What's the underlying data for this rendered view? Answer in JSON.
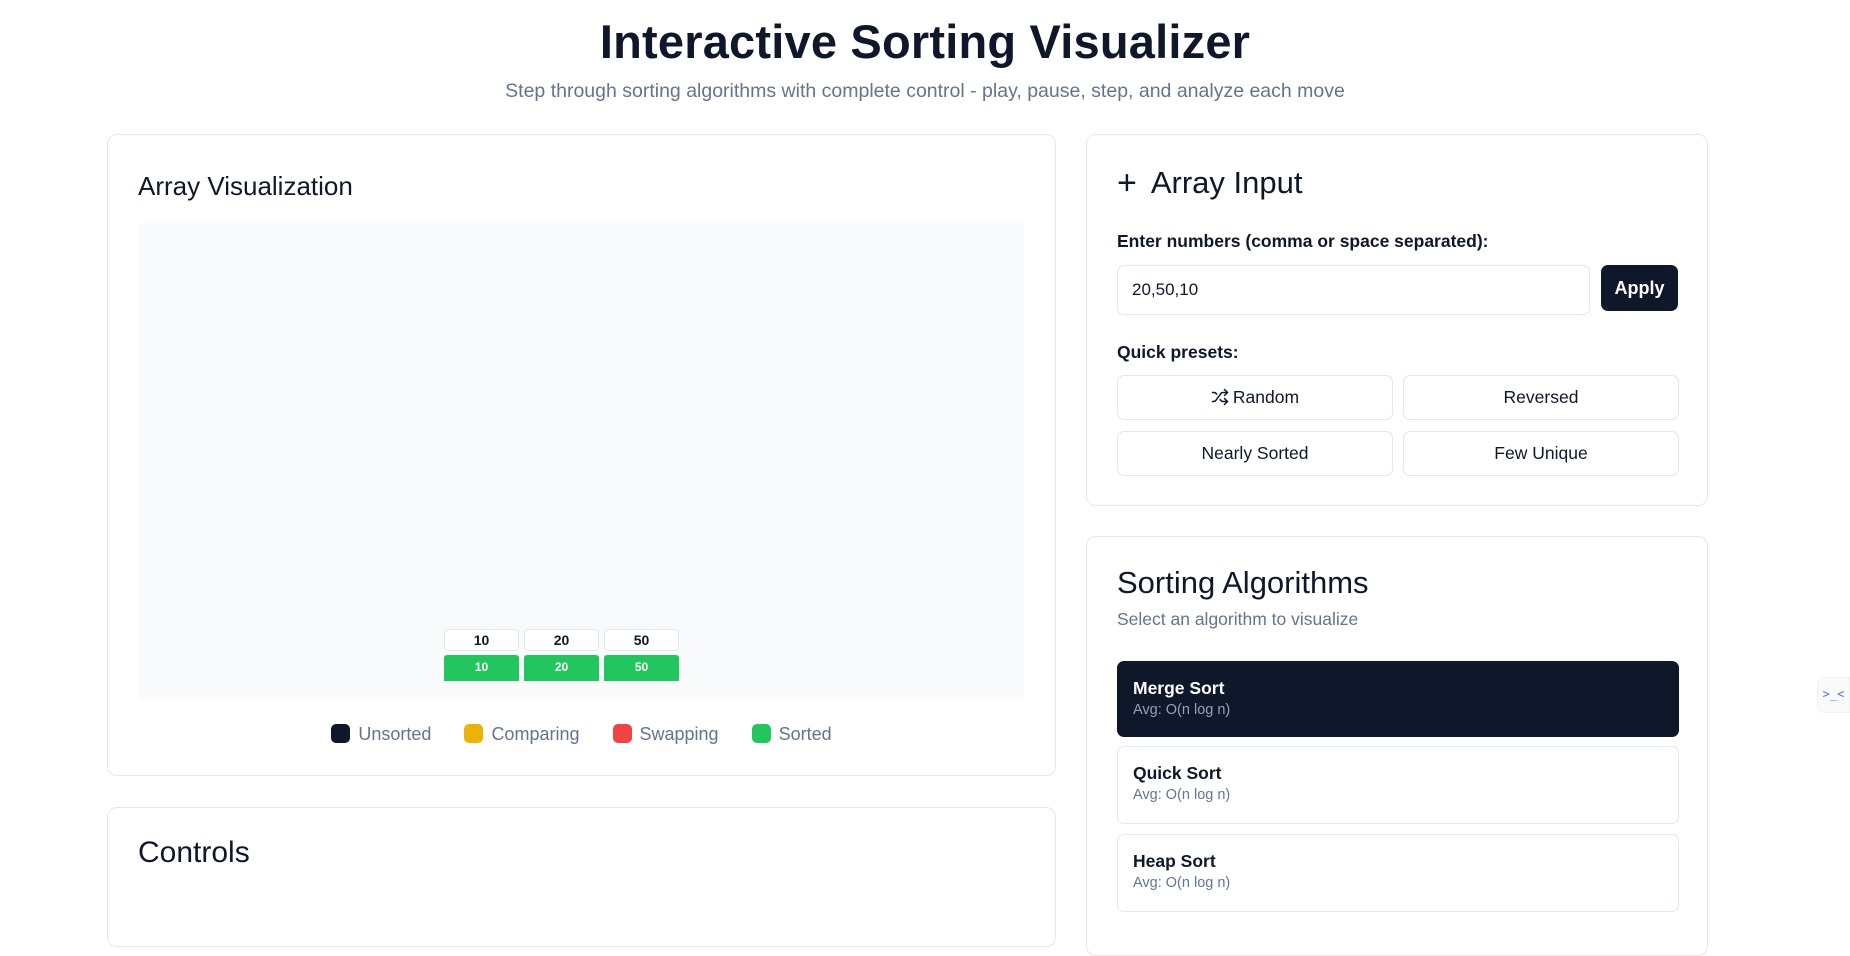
{
  "header": {
    "title": "Interactive Sorting Visualizer",
    "subtitle": "Step through sorting algorithms with complete control - play, pause, step, and analyze each move"
  },
  "visualization": {
    "title": "Array Visualization",
    "bars": [
      {
        "label": "10",
        "value": 10,
        "state": "sorted"
      },
      {
        "label": "20",
        "value": 20,
        "state": "sorted"
      },
      {
        "label": "50",
        "value": 50,
        "state": "sorted"
      }
    ],
    "legend": [
      {
        "label": "Unsorted",
        "color": "#0f172a"
      },
      {
        "label": "Comparing",
        "color": "#eab308"
      },
      {
        "label": "Swapping",
        "color": "#ef4444"
      },
      {
        "label": "Sorted",
        "color": "#22c55e"
      }
    ]
  },
  "controls": {
    "title": "Controls"
  },
  "array_input": {
    "title": "Array Input",
    "icon": "plus-icon",
    "field_label": "Enter numbers (comma or space separated):",
    "value": "20,50,10",
    "apply_label": "Apply",
    "presets_label": "Quick presets:",
    "presets": {
      "random": "Random",
      "reversed": "Reversed",
      "nearly_sorted": "Nearly Sorted",
      "few_unique": "Few Unique"
    }
  },
  "algorithms": {
    "title": "Sorting Algorithms",
    "subtitle": "Select an algorithm to visualize",
    "items": [
      {
        "name": "Merge Sort",
        "complexity": "Avg: O(n log n)",
        "selected": true
      },
      {
        "name": "Quick Sort",
        "complexity": "Avg: O(n log n)",
        "selected": false
      },
      {
        "name": "Heap Sort",
        "complexity": "Avg: O(n log n)",
        "selected": false
      }
    ]
  },
  "side_widget": {
    "icon": "terminal-icon",
    "text": ">_<"
  },
  "colors": {
    "primary": "#0f172a",
    "sorted": "#22c55e",
    "muted": "#64748b",
    "border": "#e2e8f0"
  }
}
